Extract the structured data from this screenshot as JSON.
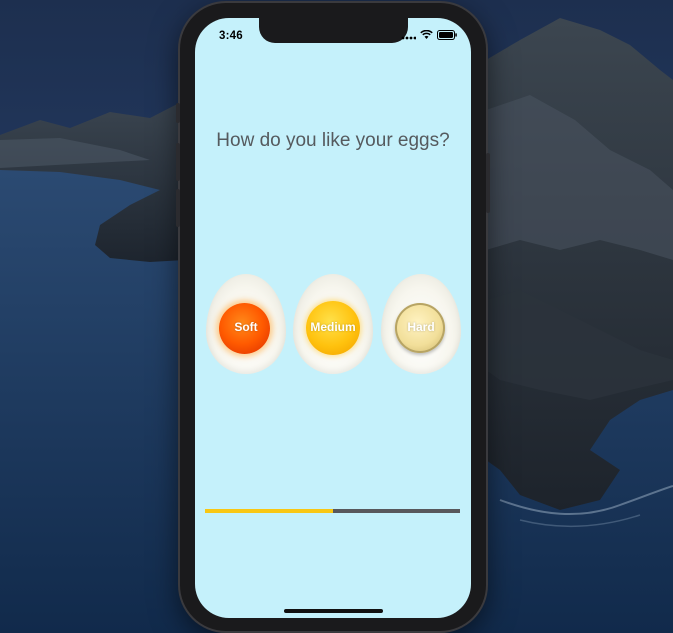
{
  "status_bar": {
    "time": "3:46"
  },
  "app": {
    "question": "How do you like your eggs?",
    "eggs": [
      {
        "label": "Soft",
        "yolk_color": "#ff5a00"
      },
      {
        "label": "Medium",
        "yolk_color": "#ffc20e"
      },
      {
        "label": "Hard",
        "yolk_color": "#f2df9a"
      }
    ],
    "progress": 0.5,
    "progress_color": "#f8c713",
    "track_color": "#58585c",
    "background_color": "#c5f1fb"
  },
  "icons": [
    "signal-icon",
    "wifi-icon",
    "battery-icon"
  ]
}
